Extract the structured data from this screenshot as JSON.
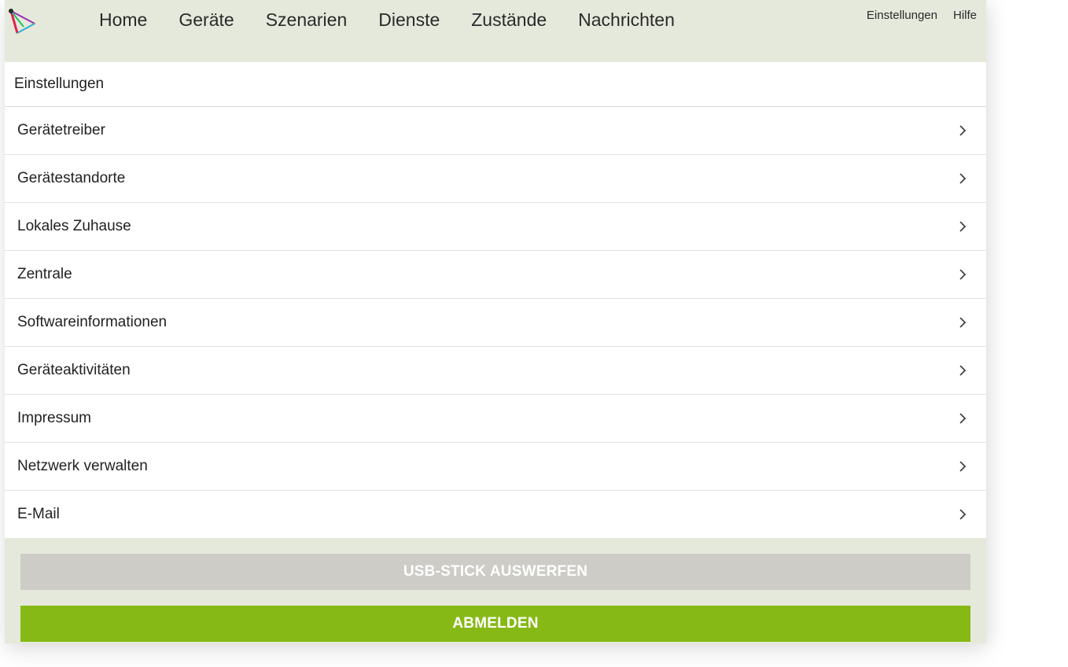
{
  "app": {
    "logo_icon": "app-logo-triangle-icon"
  },
  "nav": {
    "items": [
      {
        "label": "Home"
      },
      {
        "label": "Geräte"
      },
      {
        "label": "Szenarien"
      },
      {
        "label": "Dienste"
      },
      {
        "label": "Zustände"
      },
      {
        "label": "Nachrichten"
      }
    ]
  },
  "utility": {
    "settings_label": "Einstellungen",
    "help_label": "Hilfe"
  },
  "settings": {
    "title": "Einstellungen",
    "items": [
      {
        "label": "Gerätetreiber"
      },
      {
        "label": "Gerätestandorte"
      },
      {
        "label": "Lokales Zuhause"
      },
      {
        "label": "Zentrale"
      },
      {
        "label": "Softwareinformationen"
      },
      {
        "label": "Geräteaktivitäten"
      },
      {
        "label": "Impressum"
      },
      {
        "label": "Netzwerk verwalten"
      },
      {
        "label": "E-Mail"
      }
    ],
    "chevron_icon": "chevron-right-icon"
  },
  "actions": {
    "eject_label": "USB-STICK AUSWERFEN",
    "logout_label": "ABMELDEN"
  },
  "colors": {
    "header_bg": "#e5e9dc",
    "eject_bg": "#cdccc7",
    "logout_bg": "#86b916"
  }
}
